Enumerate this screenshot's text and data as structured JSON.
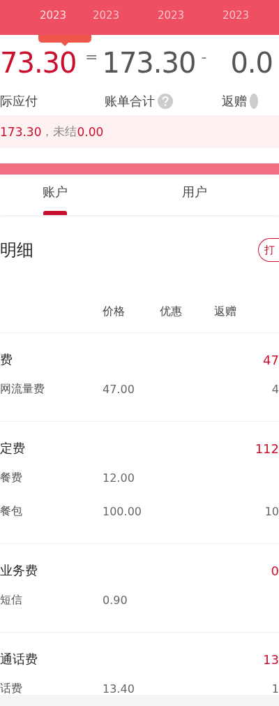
{
  "months": [
    {
      "year": "2023",
      "selected": true
    },
    {
      "year": "2023",
      "selected": false
    },
    {
      "year": "2023",
      "selected": false
    },
    {
      "year": "2023",
      "selected": false
    }
  ],
  "summary": {
    "paid": "73.30",
    "paid_label": "际应付",
    "op1": "=",
    "total": "173.30",
    "total_label": "账单合计",
    "op2": "-",
    "gift": "0.0",
    "gift_label": "返赠"
  },
  "notice": {
    "settled": "173.30",
    "unsettled_label": "，未结",
    "unsettled": "0.00"
  },
  "tabs": [
    {
      "label": "账户",
      "selected": true
    },
    {
      "label": "用户",
      "selected": false
    }
  ],
  "section": {
    "title": "明细",
    "button": "打"
  },
  "columns": [
    "价格",
    "优惠",
    "返赠"
  ],
  "groups": [
    {
      "name": "费",
      "amount": "47",
      "items": [
        {
          "name": "网流量费",
          "price": "47.00",
          "amount": "4"
        }
      ]
    },
    {
      "name": "定费",
      "amount": "112",
      "items": [
        {
          "name": "餐费",
          "price": "12.00"
        },
        {
          "name": "餐包",
          "price": "100.00",
          "amount": "10"
        }
      ]
    },
    {
      "name": "业务费",
      "amount": "0",
      "items": [
        {
          "name": "短信",
          "price": "0.90"
        }
      ]
    },
    {
      "name": "通话费",
      "amount": "13",
      "items": [
        {
          "name": "话费",
          "price": "13.40",
          "amount": "1"
        }
      ]
    }
  ]
}
